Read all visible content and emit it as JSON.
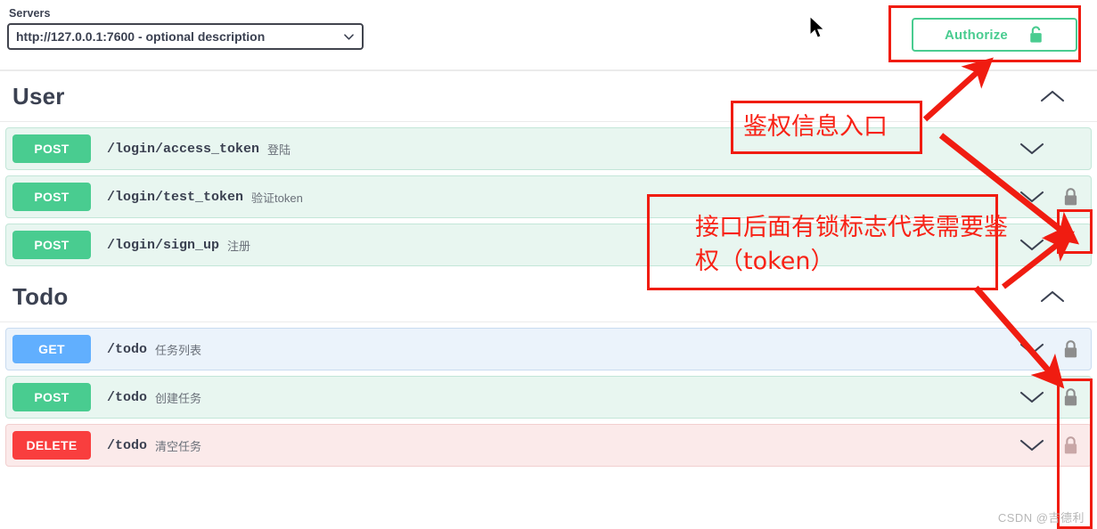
{
  "topbar": {
    "servers_label": "Servers",
    "server_value": "http://127.0.0.1:7600 - optional description",
    "dropdown_icon": "chevron-down-icon",
    "authorize_label": "Authorize",
    "authorize_icon": "unlocked-padlock-icon",
    "authorize_color": "#49cc90",
    "cursor_icon": "mouse-arrow-cursor"
  },
  "sections": [
    {
      "title": "User",
      "toggle_icon": "chevron-up-icon",
      "operations": [
        {
          "verb": "POST",
          "verb_class": "post",
          "path": "/login/access_token",
          "summary": "登陆",
          "expand_icon": "chevron-down-icon",
          "lock": false,
          "lock_icon": ""
        },
        {
          "verb": "POST",
          "verb_class": "post",
          "path": "/login/test_token",
          "summary": "验证token",
          "expand_icon": "chevron-down-icon",
          "lock": true,
          "lock_icon": "locked-padlock-icon"
        },
        {
          "verb": "POST",
          "verb_class": "post",
          "path": "/login/sign_up",
          "summary": "注册",
          "expand_icon": "chevron-down-icon",
          "lock": false,
          "lock_icon": ""
        }
      ]
    },
    {
      "title": "Todo",
      "toggle_icon": "chevron-up-icon",
      "operations": [
        {
          "verb": "GET",
          "verb_class": "get",
          "path": "/todo",
          "summary": "任务列表",
          "expand_icon": "chevron-down-icon",
          "lock": true,
          "lock_icon": "locked-padlock-icon"
        },
        {
          "verb": "POST",
          "verb_class": "post",
          "path": "/todo",
          "summary": "创建任务",
          "expand_icon": "chevron-down-icon",
          "lock": true,
          "lock_icon": "locked-padlock-icon"
        },
        {
          "verb": "DELETE",
          "verb_class": "delete",
          "path": "/todo",
          "summary": "清空任务",
          "expand_icon": "chevron-down-icon",
          "lock": true,
          "lock_icon": "locked-padlock-icon"
        }
      ]
    }
  ],
  "annotations": {
    "color": "#f82216",
    "note_1": "鉴权信息入口",
    "note_2_line_1": "接口后面有锁标志代表需要鉴",
    "note_2_line_2": "权（token）"
  },
  "watermark": "CSDN @吉德利"
}
